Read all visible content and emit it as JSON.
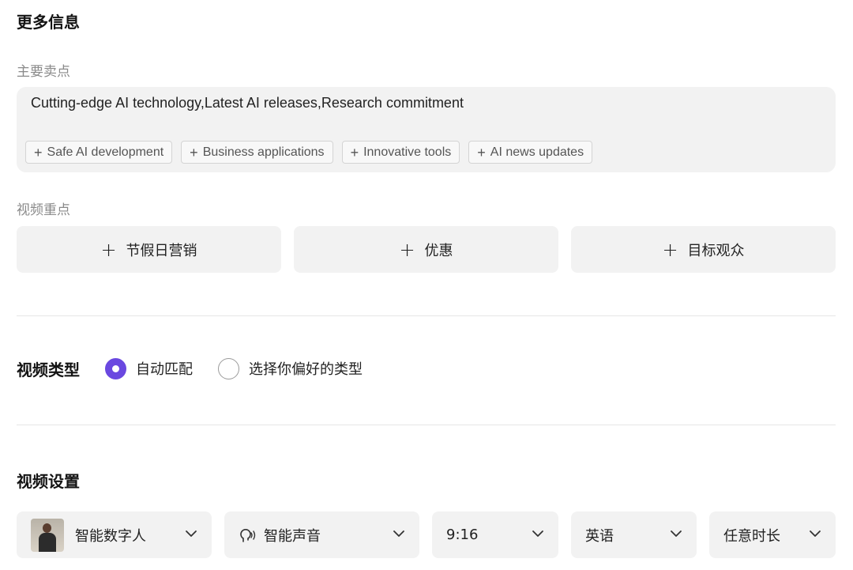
{
  "more_info": {
    "title": "更多信息"
  },
  "selling_points": {
    "label": "主要卖点",
    "value": "Cutting-edge AI technology,Latest AI releases,Research commitment",
    "suggestions": [
      "Safe AI development",
      "Business applications",
      "Innovative tools",
      "AI news updates"
    ]
  },
  "video_focus": {
    "label": "视频重点",
    "options": [
      "节假日营销",
      "优惠",
      "目标观众"
    ]
  },
  "video_type": {
    "title": "视频类型",
    "options": [
      {
        "label": "自动匹配",
        "checked": true
      },
      {
        "label": "选择你偏好的类型",
        "checked": false
      }
    ]
  },
  "video_settings": {
    "title": "视频设置",
    "avatar": "智能数字人",
    "voice": "智能声音",
    "ratio": "9:16",
    "language": "英语",
    "duration": "任意时长"
  },
  "icons": {
    "add": "plus-icon",
    "dropdown": "chevron-down-icon",
    "voice": "voice-icon"
  },
  "colors": {
    "accent": "#6a48e0",
    "panel": "#f2f2f2",
    "muted_text": "#8a8a8a"
  }
}
